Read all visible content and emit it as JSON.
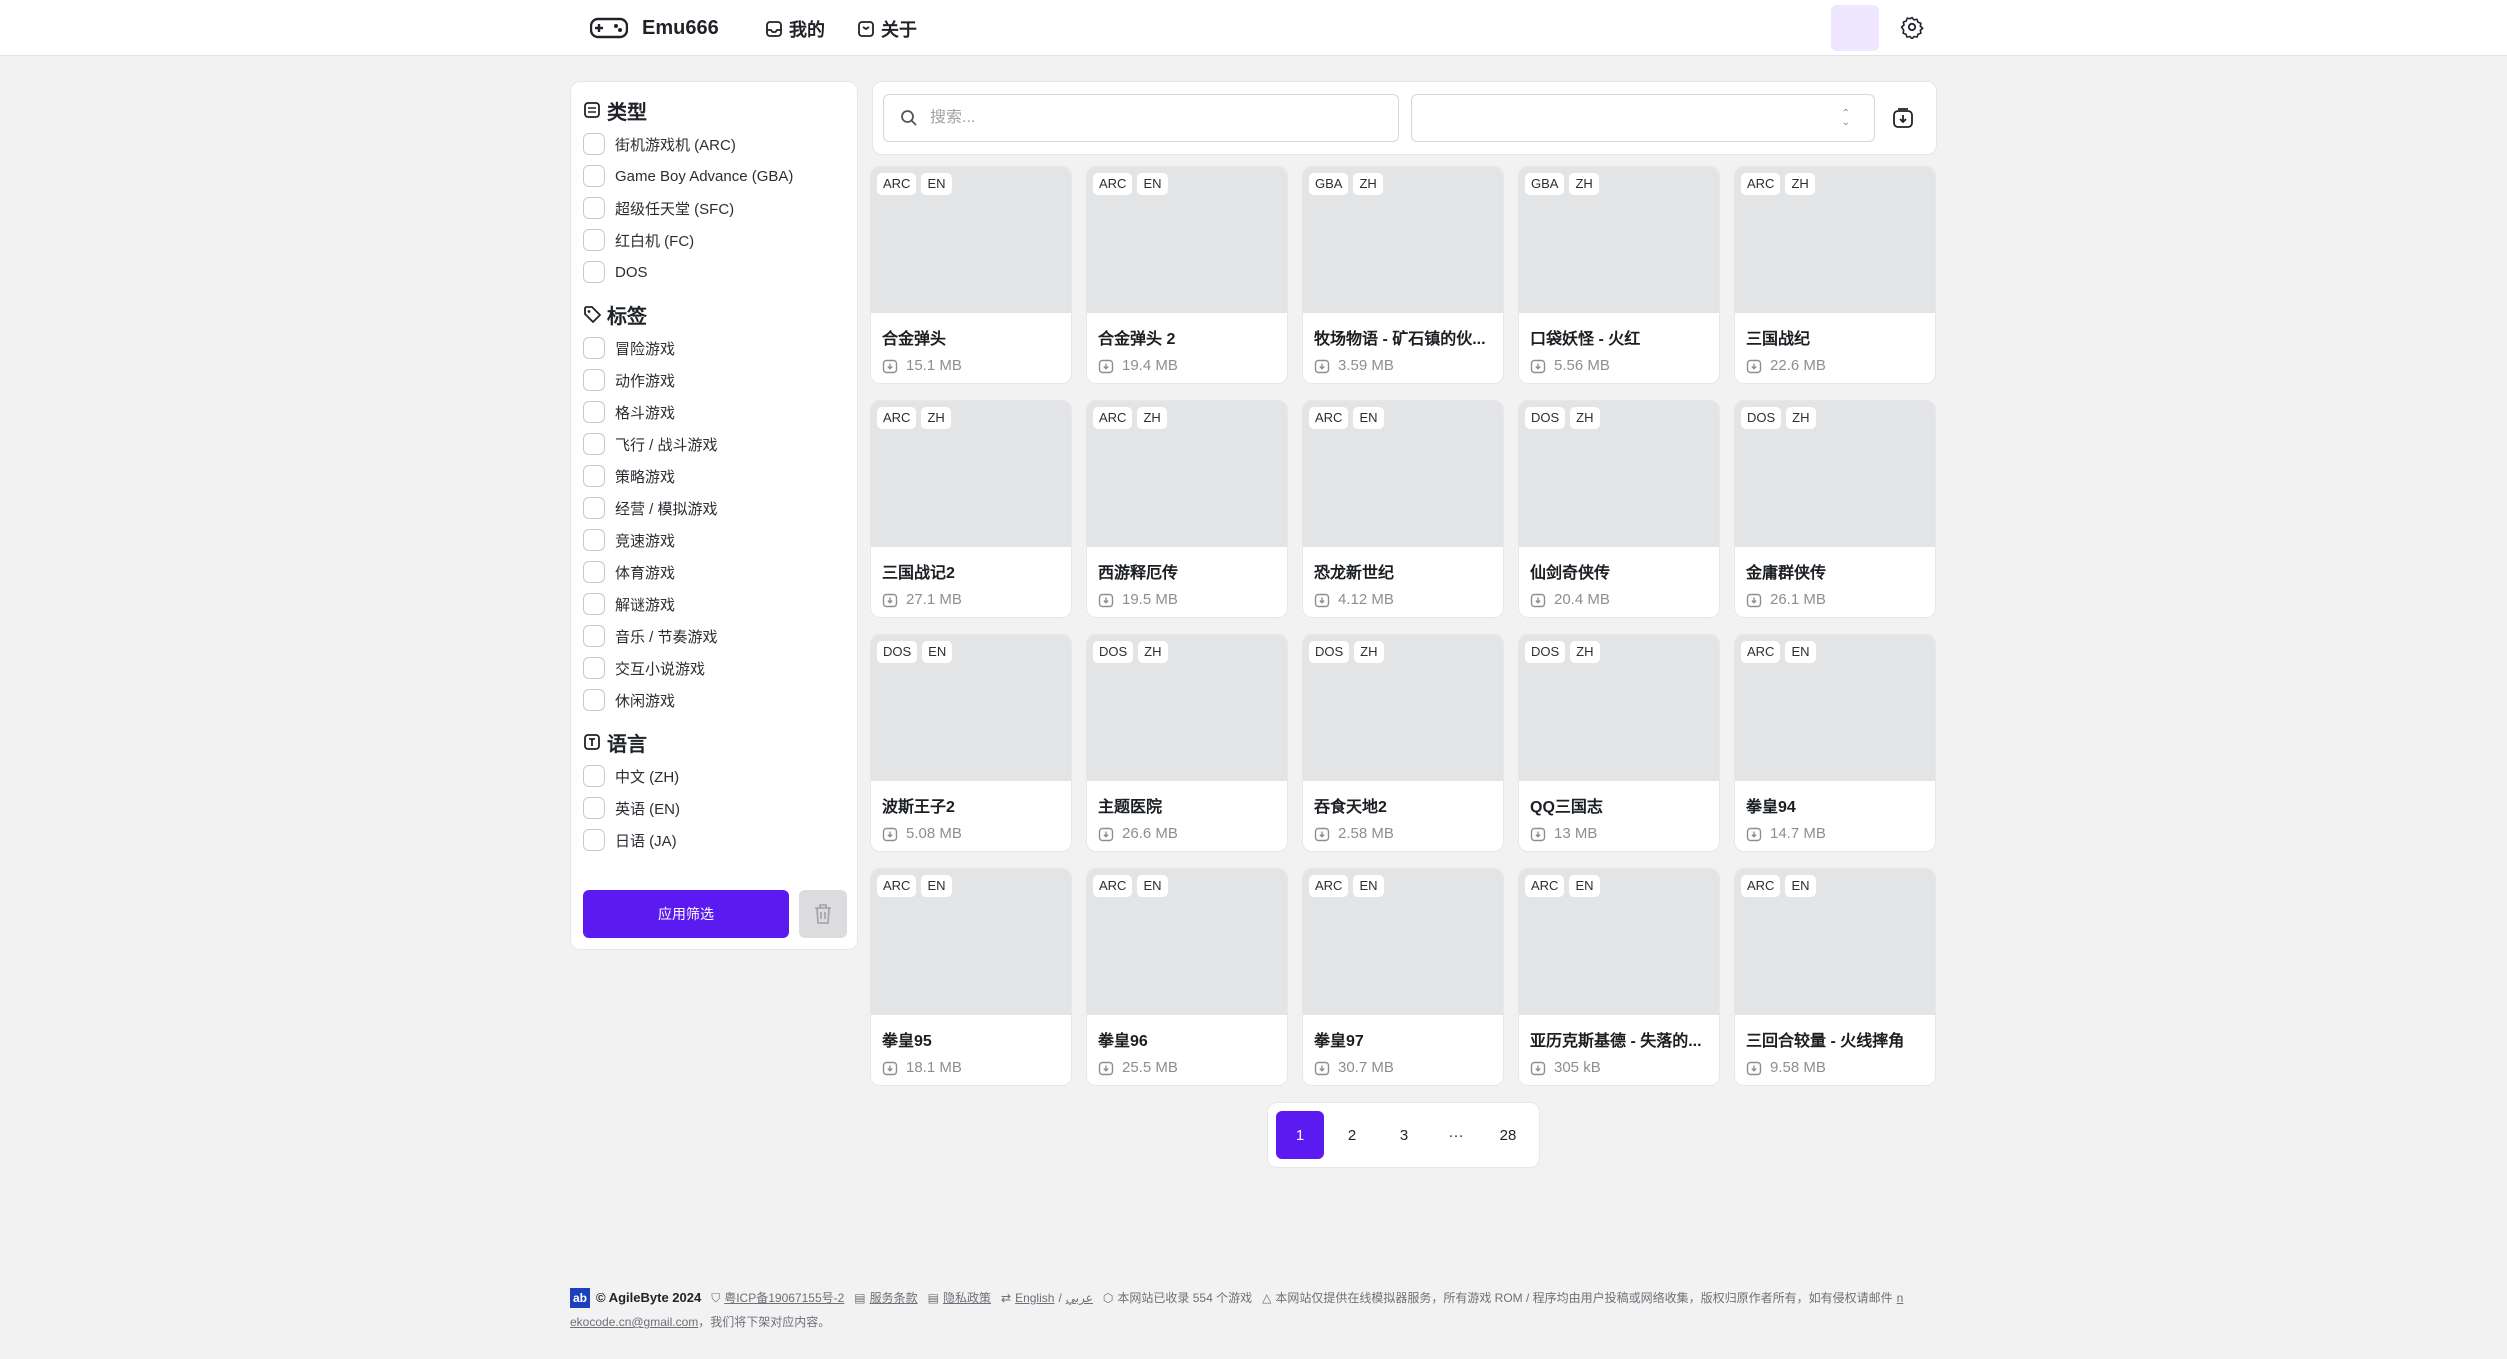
{
  "header": {
    "brand": "Emu666",
    "nav": [
      "我的",
      "关于"
    ]
  },
  "filters": {
    "type_title": "类型",
    "types": [
      "街机游戏机 (ARC)",
      "Game Boy Advance (GBA)",
      "超级任天堂 (SFC)",
      "红白机 (FC)",
      "DOS"
    ],
    "tag_title": "标签",
    "tags": [
      "冒险游戏",
      "动作游戏",
      "格斗游戏",
      "飞行 / 战斗游戏",
      "策略游戏",
      "经营 / 模拟游戏",
      "竞速游戏",
      "体育游戏",
      "解谜游戏",
      "音乐 / 节奏游戏",
      "交互小说游戏",
      "休闲游戏"
    ],
    "lang_title": "语言",
    "langs": [
      "中文 (ZH)",
      "英语 (EN)",
      "日语 (JA)"
    ],
    "apply_label": "应用筛选"
  },
  "search": {
    "placeholder": "搜索..."
  },
  "games": [
    {
      "platform": "ARC",
      "lang": "EN",
      "title": "合金弹头",
      "size": "15.1 MB"
    },
    {
      "platform": "ARC",
      "lang": "EN",
      "title": "合金弹头 2",
      "size": "19.4 MB"
    },
    {
      "platform": "GBA",
      "lang": "ZH",
      "title": "牧场物语 - 矿石镇的伙...",
      "size": "3.59 MB"
    },
    {
      "platform": "GBA",
      "lang": "ZH",
      "title": "口袋妖怪 - 火红",
      "size": "5.56 MB"
    },
    {
      "platform": "ARC",
      "lang": "ZH",
      "title": "三国战纪",
      "size": "22.6 MB"
    },
    {
      "platform": "ARC",
      "lang": "ZH",
      "title": "三国战记2",
      "size": "27.1 MB"
    },
    {
      "platform": "ARC",
      "lang": "ZH",
      "title": "西游释厄传",
      "size": "19.5 MB"
    },
    {
      "platform": "ARC",
      "lang": "EN",
      "title": "恐龙新世纪",
      "size": "4.12 MB"
    },
    {
      "platform": "DOS",
      "lang": "ZH",
      "title": "仙剑奇侠传",
      "size": "20.4 MB"
    },
    {
      "platform": "DOS",
      "lang": "ZH",
      "title": "金庸群侠传",
      "size": "26.1 MB"
    },
    {
      "platform": "DOS",
      "lang": "EN",
      "title": "波斯王子2",
      "size": "5.08 MB"
    },
    {
      "platform": "DOS",
      "lang": "ZH",
      "title": "主题医院",
      "size": "26.6 MB"
    },
    {
      "platform": "DOS",
      "lang": "ZH",
      "title": "吞食天地2",
      "size": "2.58 MB"
    },
    {
      "platform": "DOS",
      "lang": "ZH",
      "title": "QQ三国志",
      "size": "13 MB"
    },
    {
      "platform": "ARC",
      "lang": "EN",
      "title": "拳皇94",
      "size": "14.7 MB"
    },
    {
      "platform": "ARC",
      "lang": "EN",
      "title": "拳皇95",
      "size": "18.1 MB"
    },
    {
      "platform": "ARC",
      "lang": "EN",
      "title": "拳皇96",
      "size": "25.5 MB"
    },
    {
      "platform": "ARC",
      "lang": "EN",
      "title": "拳皇97",
      "size": "30.7 MB"
    },
    {
      "platform": "ARC",
      "lang": "EN",
      "title": "亚历克斯基德 - 失落的...",
      "size": "305 kB"
    },
    {
      "platform": "ARC",
      "lang": "EN",
      "title": "三回合较量 - 火线摔角",
      "size": "9.58 MB"
    }
  ],
  "pagination": {
    "pages": [
      "1",
      "2",
      "3",
      "···",
      "28"
    ],
    "current": "1"
  },
  "footer": {
    "logo_text": "ab",
    "copyright": "© AgileByte 2024",
    "icp": "粤ICP备19067155号-2",
    "terms": "服务条款",
    "privacy": "隐私政策",
    "lang_en": "English",
    "lang_sep": "/",
    "lang_ar": "عربي",
    "count": "本网站已收录 554 个游戏",
    "notice": "本网站仅提供在线模拟器服务，所有游戏 ROM / 程序均由用户投稿或网络收集，版权归原作者所有，如有侵权请邮件",
    "email_a": "n",
    "email_b": "ekocode.cn@gmail.com",
    "notice_end": "，我们将下架对应内容。"
  },
  "colors": {
    "accent": "#5b1af0",
    "thumb": "#e3e4e5",
    "bg": "#f2f2f3"
  },
  "icons": {
    "brand": "gamepad-icon",
    "settings": "gear-icon",
    "search": "search-icon",
    "download": "download-icon"
  }
}
